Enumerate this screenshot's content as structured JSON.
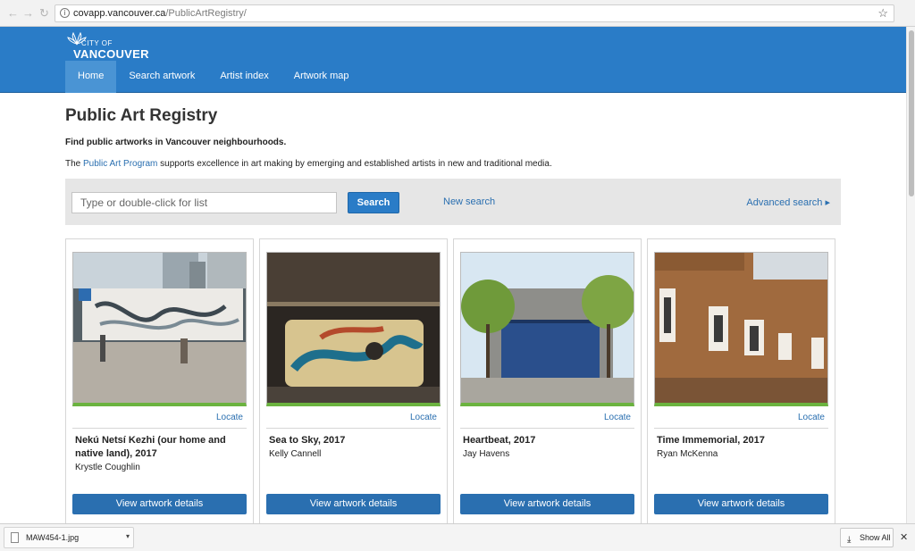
{
  "browser": {
    "back_icon": "←",
    "forward_icon": "→",
    "reload_icon": "↻",
    "url_domain": "covapp.vancouver.ca",
    "url_path": "/PublicArtRegistry/",
    "star_icon": "☆"
  },
  "site": {
    "logo_city": "CITY OF",
    "logo_name": "VANCOUVER",
    "nav": [
      "Home",
      "Search artwork",
      "Artist index",
      "Artwork map"
    ]
  },
  "page": {
    "title": "Public Art Registry",
    "lead": "Find public artworks in Vancouver neighbourhoods.",
    "intro_pre": "The ",
    "intro_link": "Public Art Program",
    "intro_post": " supports excellence in art making by emerging and established artists in new and traditional media."
  },
  "search": {
    "placeholder": "Type or double-click for list",
    "button": "Search",
    "new_search": "New search",
    "advanced": "Advanced search ▸"
  },
  "cards": [
    {
      "title": "Nekú Netsí Kezhi (our home and native land), 2017",
      "artist": "Krystle Coughlin",
      "locate": "Locate",
      "button": "View artwork details"
    },
    {
      "title": "Sea to Sky, 2017",
      "artist": "Kelly Cannell",
      "locate": "Locate",
      "button": "View artwork details"
    },
    {
      "title": "Heartbeat, 2017",
      "artist": "Jay Havens",
      "locate": "Locate",
      "button": "View artwork details"
    },
    {
      "title": "Time Immemorial, 2017",
      "artist": "Ryan McKenna",
      "locate": "Locate",
      "button": "View artwork details"
    }
  ],
  "downloads": {
    "file": "MAW454-1.jpg",
    "show_all": "Show All",
    "close": "✕"
  },
  "colors": {
    "brand_blue": "#2a7cc7",
    "link_blue": "#2a6fb0",
    "accent_green": "#6bb33f"
  }
}
